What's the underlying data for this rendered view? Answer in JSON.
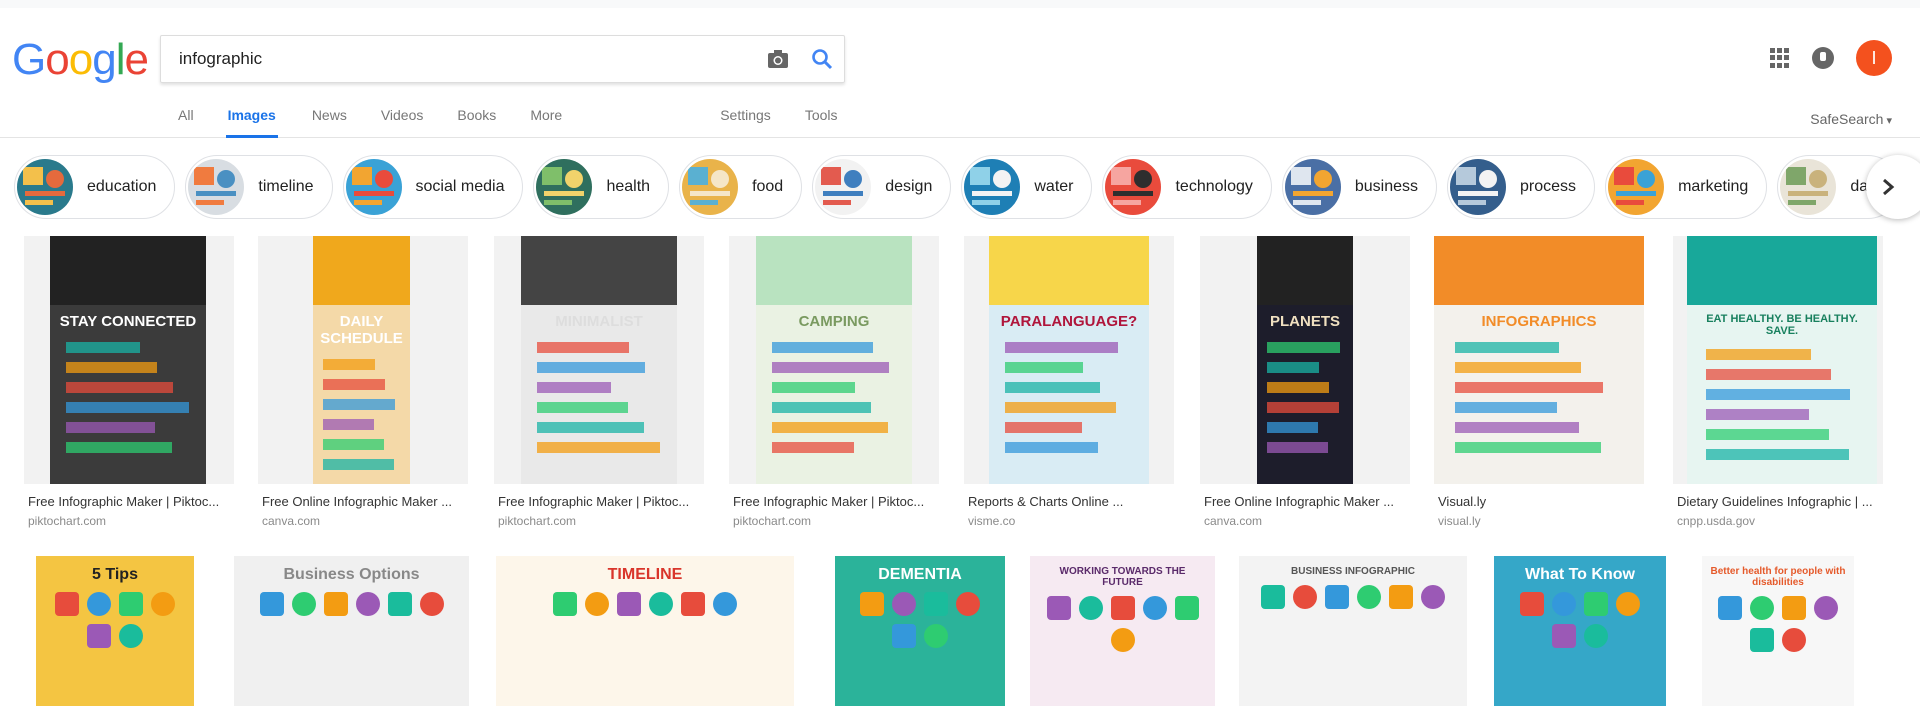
{
  "brand": {
    "logo_text": [
      "G",
      "o",
      "o",
      "g",
      "l",
      "e"
    ]
  },
  "search": {
    "query": "infographic"
  },
  "tabs": [
    {
      "label": "All"
    },
    {
      "label": "Images",
      "active": true
    },
    {
      "label": "News"
    },
    {
      "label": "Videos"
    },
    {
      "label": "Books"
    },
    {
      "label": "More"
    },
    {
      "label": "Settings"
    },
    {
      "label": "Tools"
    }
  ],
  "safesearch": "SafeSearch",
  "avatar_letter": "I",
  "chips": [
    "education",
    "timeline",
    "social media",
    "health",
    "food",
    "design",
    "water",
    "technology",
    "business",
    "process",
    "marketing",
    "data"
  ],
  "results_row1": [
    {
      "caption": "Free Infographic Maker | Piktoc...",
      "source": "piktochart.com",
      "poster_text": "STAY CONNECTED"
    },
    {
      "caption": "Free Online Infographic Maker ...",
      "source": "canva.com",
      "poster_text": "DAILY SCHEDULE"
    },
    {
      "caption": "Free Infographic Maker | Piktoc...",
      "source": "piktochart.com",
      "poster_text": "MINIMALIST"
    },
    {
      "caption": "Free Infographic Maker | Piktoc...",
      "source": "piktochart.com",
      "poster_text": "CAMPING"
    },
    {
      "caption": "Reports & Charts Online ...",
      "source": "visme.co",
      "poster_text": "PARALANGUAGE?"
    },
    {
      "caption": "Free Online Infographic Maker ...",
      "source": "canva.com",
      "poster_text": "PLANETS"
    },
    {
      "caption": "Visual.ly",
      "source": "visual.ly",
      "poster_text": "INFOGRAPHICS"
    },
    {
      "caption": "Dietary Guidelines Infographic | ...",
      "source": "cnpp.usda.gov",
      "poster_text": "EAT HEALTHY. BE HEALTHY. SAVE."
    }
  ],
  "results_row2": [
    {
      "poster_text": "5 Tips"
    },
    {
      "poster_text": "Business Options"
    },
    {
      "poster_text": "TIMELINE"
    },
    {
      "poster_text": "DEMENTIA"
    },
    {
      "poster_text": "WORKING TOWARDS THE FUTURE"
    },
    {
      "poster_text": "BUSINESS INFOGRAPHIC"
    },
    {
      "poster_text": "What To Know"
    },
    {
      "poster_text": "Better health for people with disabilities"
    }
  ],
  "colors": {
    "accent": "#1a73e8",
    "avatar": "#f4511e"
  }
}
